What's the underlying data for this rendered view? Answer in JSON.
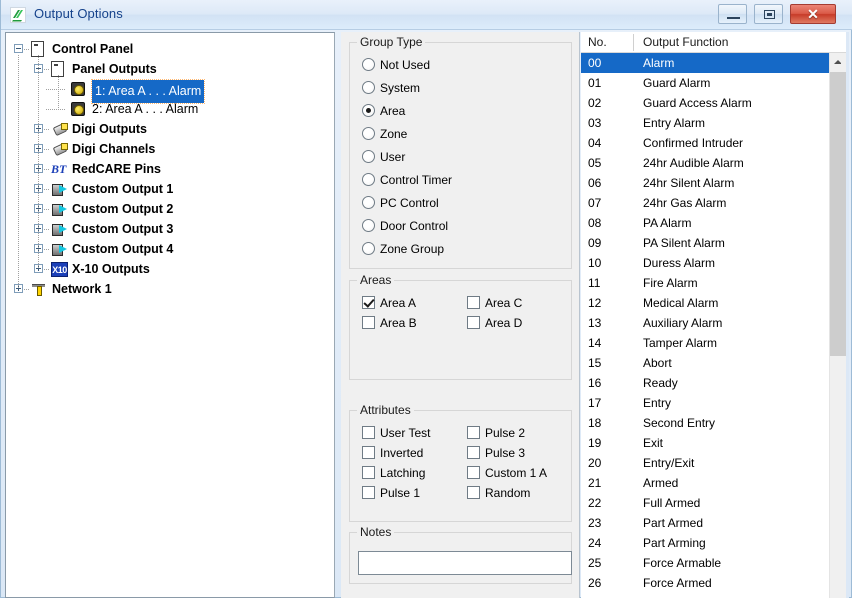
{
  "window": {
    "title": "Output Options",
    "app_icon": "output-options-icon",
    "buttons": {
      "minimize": "minimize-icon",
      "maximize": "maximize-icon",
      "close": "✕"
    }
  },
  "tree": {
    "nodes": [
      {
        "label": "Control Panel",
        "icon": "panel-icon",
        "state": "expanded",
        "depth": 0,
        "bold": true,
        "selected": false
      },
      {
        "label": "Panel Outputs",
        "icon": "panel-icon",
        "state": "expanded",
        "depth": 1,
        "bold": true,
        "selected": false
      },
      {
        "label": "1: Area A . . . Alarm",
        "icon": "output-icon",
        "state": "leaf",
        "depth": 2,
        "bold": false,
        "selected": true
      },
      {
        "label": "2: Area A . . . Alarm",
        "icon": "output-icon",
        "state": "leaf",
        "depth": 2,
        "bold": false,
        "selected": false
      },
      {
        "label": "Digi Outputs",
        "icon": "plug-icon",
        "state": "collapsed",
        "depth": 1,
        "bold": true,
        "selected": false
      },
      {
        "label": "Digi Channels",
        "icon": "plug-icon",
        "state": "collapsed",
        "depth": 1,
        "bold": true,
        "selected": false
      },
      {
        "label": "RedCARE Pins",
        "icon": "bt-icon",
        "state": "collapsed",
        "depth": 1,
        "bold": true,
        "selected": false
      },
      {
        "label": "Custom Output 1",
        "icon": "custom-output-icon",
        "state": "collapsed",
        "depth": 1,
        "bold": true,
        "selected": false
      },
      {
        "label": "Custom Output 2",
        "icon": "custom-output-icon",
        "state": "collapsed",
        "depth": 1,
        "bold": true,
        "selected": false
      },
      {
        "label": "Custom Output 3",
        "icon": "custom-output-icon",
        "state": "collapsed",
        "depth": 1,
        "bold": true,
        "selected": false
      },
      {
        "label": "Custom Output 4",
        "icon": "custom-output-icon",
        "state": "collapsed",
        "depth": 1,
        "bold": true,
        "selected": false
      },
      {
        "label": "X-10 Outputs",
        "icon": "x10-icon",
        "state": "collapsed",
        "depth": 1,
        "bold": true,
        "selected": false
      },
      {
        "label": "Network 1",
        "icon": "network-icon",
        "state": "collapsed",
        "depth": 0,
        "bold": true,
        "selected": false
      }
    ],
    "x10_icon_text": "X10",
    "bt_icon_text": "BT"
  },
  "group_type": {
    "title": "Group Type",
    "selected": "Area",
    "options": [
      "Not Used",
      "System",
      "Area",
      "Zone",
      "User",
      "Control Timer",
      "PC Control",
      "Door Control",
      "Zone Group"
    ]
  },
  "areas": {
    "title": "Areas",
    "items": [
      {
        "label": "Area A",
        "checked": true,
        "col": 0,
        "row": 0
      },
      {
        "label": "Area B",
        "checked": false,
        "col": 0,
        "row": 1
      },
      {
        "label": "Area C",
        "checked": false,
        "col": 1,
        "row": 0
      },
      {
        "label": "Area D",
        "checked": false,
        "col": 1,
        "row": 1
      }
    ]
  },
  "attributes": {
    "title": "Attributes",
    "items": [
      {
        "label": "User Test",
        "checked": false,
        "col": 0,
        "row": 0
      },
      {
        "label": "Inverted",
        "checked": false,
        "col": 0,
        "row": 1
      },
      {
        "label": "Latching",
        "checked": false,
        "col": 0,
        "row": 2
      },
      {
        "label": "Pulse 1",
        "checked": false,
        "col": 0,
        "row": 3
      },
      {
        "label": "Pulse 2",
        "checked": false,
        "col": 1,
        "row": 0
      },
      {
        "label": "Pulse 3",
        "checked": false,
        "col": 1,
        "row": 1
      },
      {
        "label": "Custom 1 A",
        "checked": false,
        "col": 1,
        "row": 2
      },
      {
        "label": "Random",
        "checked": false,
        "col": 1,
        "row": 3
      }
    ]
  },
  "notes": {
    "title": "Notes",
    "value": "",
    "placeholder": ""
  },
  "output_list": {
    "columns": [
      "No.",
      "Output Function"
    ],
    "selected_index": 0,
    "rows": [
      {
        "no": "00",
        "fn": "Alarm"
      },
      {
        "no": "01",
        "fn": "Guard Alarm"
      },
      {
        "no": "02",
        "fn": "Guard Access Alarm"
      },
      {
        "no": "03",
        "fn": "Entry Alarm"
      },
      {
        "no": "04",
        "fn": "Confirmed Intruder"
      },
      {
        "no": "05",
        "fn": "24hr Audible Alarm"
      },
      {
        "no": "06",
        "fn": "24hr Silent Alarm"
      },
      {
        "no": "07",
        "fn": "24hr Gas Alarm"
      },
      {
        "no": "08",
        "fn": "PA Alarm"
      },
      {
        "no": "09",
        "fn": "PA Silent Alarm"
      },
      {
        "no": "10",
        "fn": "Duress Alarm"
      },
      {
        "no": "11",
        "fn": "Fire Alarm"
      },
      {
        "no": "12",
        "fn": "Medical Alarm"
      },
      {
        "no": "13",
        "fn": "Auxiliary Alarm"
      },
      {
        "no": "14",
        "fn": "Tamper Alarm"
      },
      {
        "no": "15",
        "fn": "Abort"
      },
      {
        "no": "16",
        "fn": "Ready"
      },
      {
        "no": "17",
        "fn": "Entry"
      },
      {
        "no": "18",
        "fn": "Second Entry"
      },
      {
        "no": "19",
        "fn": "Exit"
      },
      {
        "no": "20",
        "fn": "Entry/Exit"
      },
      {
        "no": "21",
        "fn": "Armed"
      },
      {
        "no": "22",
        "fn": "Full Armed"
      },
      {
        "no": "23",
        "fn": "Part Armed"
      },
      {
        "no": "24",
        "fn": "Part Arming"
      },
      {
        "no": "25",
        "fn": "Force Armable"
      },
      {
        "no": "26",
        "fn": "Force Armed"
      }
    ]
  },
  "colors": {
    "selection_blue": "#1569c7",
    "title_text": "#15428b",
    "close_red": "#c73b28",
    "panel_bg": "#f0f0f0"
  }
}
